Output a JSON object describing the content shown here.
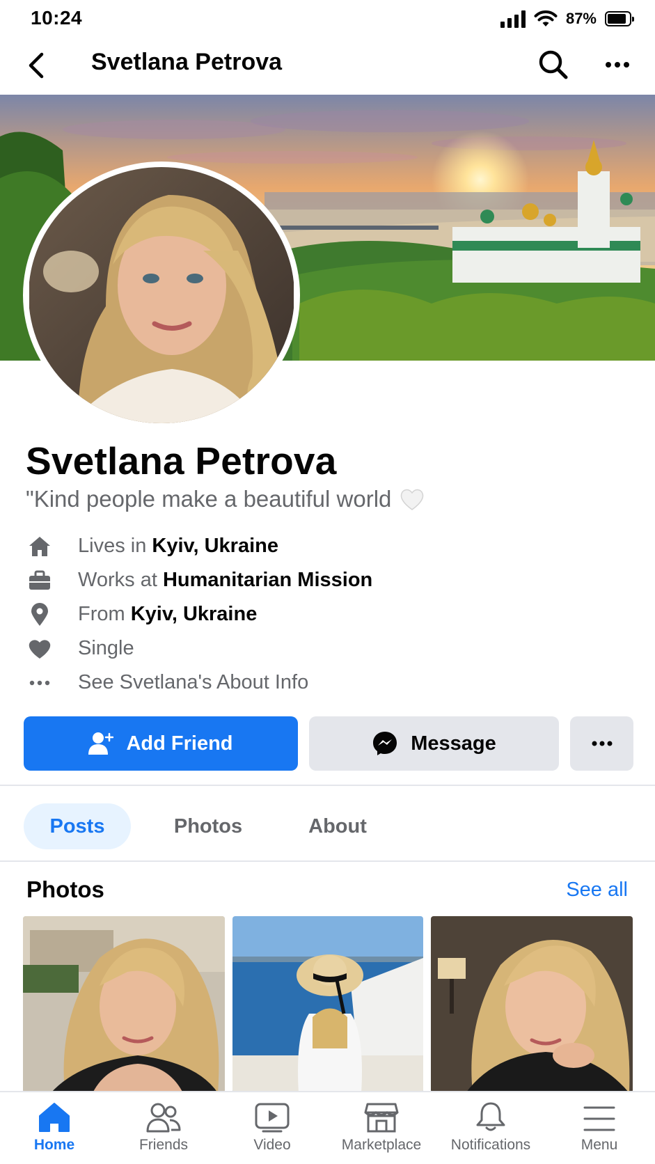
{
  "status_bar": {
    "time": "10:24",
    "battery": "87%",
    "battery_level": 0.87
  },
  "header": {
    "title": "Svetlana Petrova"
  },
  "profile": {
    "name": "Svetlana Petrova",
    "bio": "\"Kind people make a beautiful world",
    "bio_emoji_icon": "white-heart-icon"
  },
  "info": {
    "lives": {
      "prefix": "Lives in ",
      "value": "Kyiv, Ukraine",
      "icon": "home-icon"
    },
    "works": {
      "prefix": "Works at ",
      "value": "Humanitarian Mission",
      "icon": "briefcase-icon"
    },
    "from": {
      "prefix": "From ",
      "value": "Kyiv, Ukraine",
      "icon": "location-pin-icon"
    },
    "relationship": {
      "text": "Single",
      "icon": "heart-icon"
    },
    "about": {
      "text": "See Svetlana's About Info",
      "icon": "more-dots-icon"
    }
  },
  "actions": {
    "add_friend": "Add Friend",
    "message": "Message"
  },
  "tabs": [
    {
      "label": "Posts",
      "active": true
    },
    {
      "label": "Photos",
      "active": false
    },
    {
      "label": "About",
      "active": false
    }
  ],
  "photos_section": {
    "title": "Photos",
    "see_all": "See all"
  },
  "bottom_nav": [
    {
      "label": "Home",
      "icon": "home-icon",
      "active": true
    },
    {
      "label": "Friends",
      "icon": "friends-icon",
      "active": false
    },
    {
      "label": "Video",
      "icon": "video-icon",
      "active": false
    },
    {
      "label": "Marketplace",
      "icon": "marketplace-icon",
      "active": false
    },
    {
      "label": "Notifications",
      "icon": "bell-icon",
      "active": false
    },
    {
      "label": "Menu",
      "icon": "menu-icon",
      "active": false
    }
  ],
  "colors": {
    "accent": "#1877f2",
    "secondary_text": "#65676b",
    "button_gray": "#e4e6eb",
    "tab_active_bg": "#e7f3ff"
  }
}
